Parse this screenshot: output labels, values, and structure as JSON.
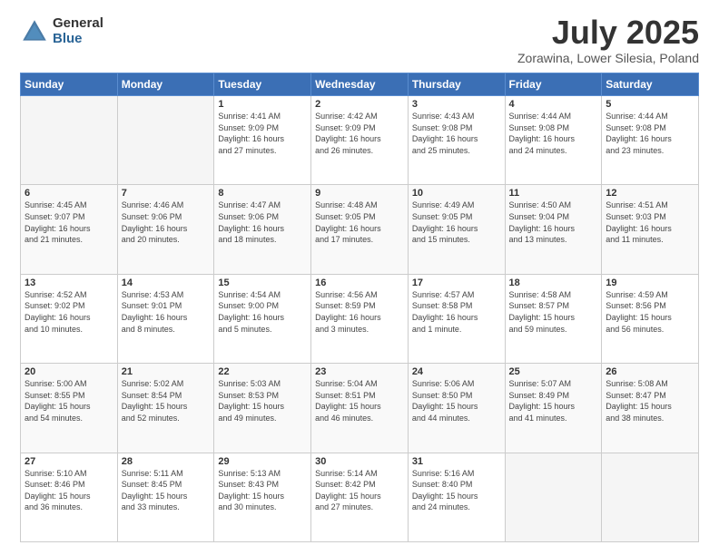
{
  "header": {
    "logo_general": "General",
    "logo_blue": "Blue",
    "month_title": "July 2025",
    "location": "Zorawina, Lower Silesia, Poland"
  },
  "weekdays": [
    "Sunday",
    "Monday",
    "Tuesday",
    "Wednesday",
    "Thursday",
    "Friday",
    "Saturday"
  ],
  "weeks": [
    [
      {
        "day": "",
        "info": ""
      },
      {
        "day": "",
        "info": ""
      },
      {
        "day": "1",
        "info": "Sunrise: 4:41 AM\nSunset: 9:09 PM\nDaylight: 16 hours\nand 27 minutes."
      },
      {
        "day": "2",
        "info": "Sunrise: 4:42 AM\nSunset: 9:09 PM\nDaylight: 16 hours\nand 26 minutes."
      },
      {
        "day": "3",
        "info": "Sunrise: 4:43 AM\nSunset: 9:08 PM\nDaylight: 16 hours\nand 25 minutes."
      },
      {
        "day": "4",
        "info": "Sunrise: 4:44 AM\nSunset: 9:08 PM\nDaylight: 16 hours\nand 24 minutes."
      },
      {
        "day": "5",
        "info": "Sunrise: 4:44 AM\nSunset: 9:08 PM\nDaylight: 16 hours\nand 23 minutes."
      }
    ],
    [
      {
        "day": "6",
        "info": "Sunrise: 4:45 AM\nSunset: 9:07 PM\nDaylight: 16 hours\nand 21 minutes."
      },
      {
        "day": "7",
        "info": "Sunrise: 4:46 AM\nSunset: 9:06 PM\nDaylight: 16 hours\nand 20 minutes."
      },
      {
        "day": "8",
        "info": "Sunrise: 4:47 AM\nSunset: 9:06 PM\nDaylight: 16 hours\nand 18 minutes."
      },
      {
        "day": "9",
        "info": "Sunrise: 4:48 AM\nSunset: 9:05 PM\nDaylight: 16 hours\nand 17 minutes."
      },
      {
        "day": "10",
        "info": "Sunrise: 4:49 AM\nSunset: 9:05 PM\nDaylight: 16 hours\nand 15 minutes."
      },
      {
        "day": "11",
        "info": "Sunrise: 4:50 AM\nSunset: 9:04 PM\nDaylight: 16 hours\nand 13 minutes."
      },
      {
        "day": "12",
        "info": "Sunrise: 4:51 AM\nSunset: 9:03 PM\nDaylight: 16 hours\nand 11 minutes."
      }
    ],
    [
      {
        "day": "13",
        "info": "Sunrise: 4:52 AM\nSunset: 9:02 PM\nDaylight: 16 hours\nand 10 minutes."
      },
      {
        "day": "14",
        "info": "Sunrise: 4:53 AM\nSunset: 9:01 PM\nDaylight: 16 hours\nand 8 minutes."
      },
      {
        "day": "15",
        "info": "Sunrise: 4:54 AM\nSunset: 9:00 PM\nDaylight: 16 hours\nand 5 minutes."
      },
      {
        "day": "16",
        "info": "Sunrise: 4:56 AM\nSunset: 8:59 PM\nDaylight: 16 hours\nand 3 minutes."
      },
      {
        "day": "17",
        "info": "Sunrise: 4:57 AM\nSunset: 8:58 PM\nDaylight: 16 hours\nand 1 minute."
      },
      {
        "day": "18",
        "info": "Sunrise: 4:58 AM\nSunset: 8:57 PM\nDaylight: 15 hours\nand 59 minutes."
      },
      {
        "day": "19",
        "info": "Sunrise: 4:59 AM\nSunset: 8:56 PM\nDaylight: 15 hours\nand 56 minutes."
      }
    ],
    [
      {
        "day": "20",
        "info": "Sunrise: 5:00 AM\nSunset: 8:55 PM\nDaylight: 15 hours\nand 54 minutes."
      },
      {
        "day": "21",
        "info": "Sunrise: 5:02 AM\nSunset: 8:54 PM\nDaylight: 15 hours\nand 52 minutes."
      },
      {
        "day": "22",
        "info": "Sunrise: 5:03 AM\nSunset: 8:53 PM\nDaylight: 15 hours\nand 49 minutes."
      },
      {
        "day": "23",
        "info": "Sunrise: 5:04 AM\nSunset: 8:51 PM\nDaylight: 15 hours\nand 46 minutes."
      },
      {
        "day": "24",
        "info": "Sunrise: 5:06 AM\nSunset: 8:50 PM\nDaylight: 15 hours\nand 44 minutes."
      },
      {
        "day": "25",
        "info": "Sunrise: 5:07 AM\nSunset: 8:49 PM\nDaylight: 15 hours\nand 41 minutes."
      },
      {
        "day": "26",
        "info": "Sunrise: 5:08 AM\nSunset: 8:47 PM\nDaylight: 15 hours\nand 38 minutes."
      }
    ],
    [
      {
        "day": "27",
        "info": "Sunrise: 5:10 AM\nSunset: 8:46 PM\nDaylight: 15 hours\nand 36 minutes."
      },
      {
        "day": "28",
        "info": "Sunrise: 5:11 AM\nSunset: 8:45 PM\nDaylight: 15 hours\nand 33 minutes."
      },
      {
        "day": "29",
        "info": "Sunrise: 5:13 AM\nSunset: 8:43 PM\nDaylight: 15 hours\nand 30 minutes."
      },
      {
        "day": "30",
        "info": "Sunrise: 5:14 AM\nSunset: 8:42 PM\nDaylight: 15 hours\nand 27 minutes."
      },
      {
        "day": "31",
        "info": "Sunrise: 5:16 AM\nSunset: 8:40 PM\nDaylight: 15 hours\nand 24 minutes."
      },
      {
        "day": "",
        "info": ""
      },
      {
        "day": "",
        "info": ""
      }
    ]
  ]
}
